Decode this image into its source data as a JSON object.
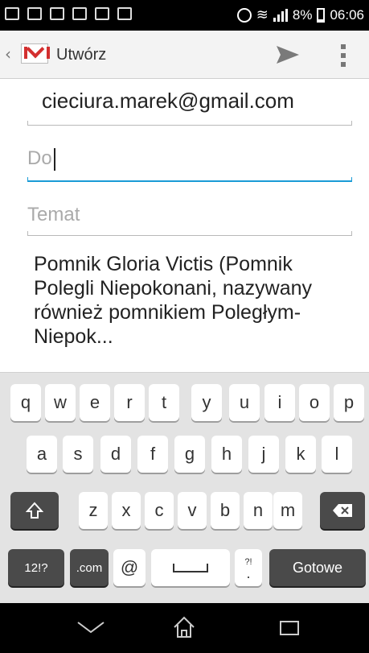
{
  "status_bar": {
    "battery": "8%",
    "time": "06:06",
    "icons": [
      "keyboard-icon",
      "signal-bars-icon",
      "screen-icon",
      "image-icon",
      "message-icon",
      "download-icon",
      "compass-icon",
      "wifi-icon",
      "battery-icon"
    ]
  },
  "action_bar": {
    "title": "Utwórz",
    "icons": [
      "back-chevron-icon",
      "gmail-logo-icon",
      "send-icon",
      "overflow-menu-icon"
    ]
  },
  "compose": {
    "from": "cieciura.marek@gmail.com",
    "to_value": "",
    "to_placeholder": "Do",
    "subject_value": "",
    "subject_placeholder": "Temat",
    "body": "Pomnik Gloria Victis (Pomnik Polegli Niepokonani, nazywany również pomnikiem Poległym-Niepok..."
  },
  "keyboard": {
    "row1": [
      "q",
      "w",
      "e",
      "r",
      "t",
      "y",
      "u",
      "i",
      "o",
      "p"
    ],
    "row2": [
      "a",
      "s",
      "d",
      "f",
      "g",
      "h",
      "j",
      "k",
      "l"
    ],
    "row3": [
      "z",
      "x",
      "c",
      "v",
      "b",
      "n",
      "m"
    ],
    "row4": {
      "symbols": "12!?",
      "dotcom": ".com",
      "at": "@",
      "punct_top": "?!",
      "punct": ".",
      "done": "Gotowe"
    },
    "icons": [
      "shift-icon",
      "backspace-icon",
      "space-bar-icon"
    ]
  },
  "nav_bar": {
    "icons": [
      "nav-back-icon",
      "nav-home-icon",
      "nav-recent-apps-icon"
    ]
  },
  "colors": {
    "accent": "#1a9bd6",
    "status_bar": "#000000",
    "action_bar": "#f3f3f3",
    "keyboard_bg": "#e3e3e3"
  }
}
